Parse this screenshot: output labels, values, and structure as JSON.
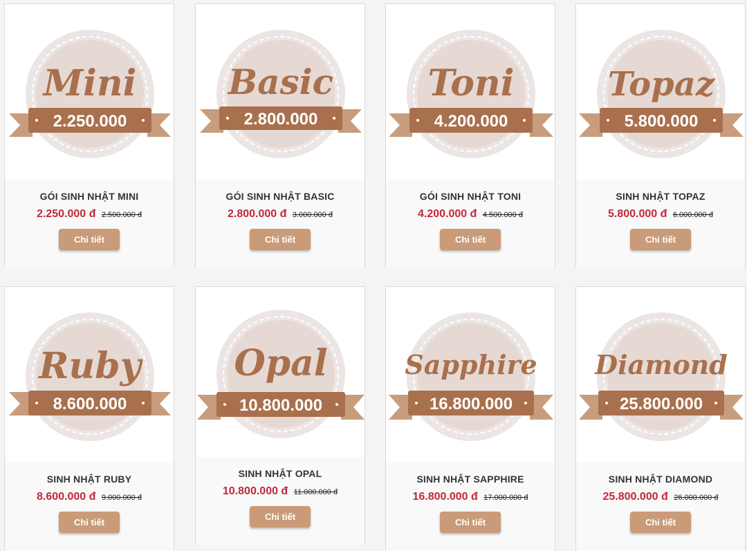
{
  "colors": {
    "price": "#c0283c",
    "button": "#c99b78",
    "ribbon": "#a9704d",
    "ribbon_light": "#c89d7d",
    "badge_ring": "#ebe5e3",
    "script_text": "#a9704d"
  },
  "packages": [
    {
      "badge_name": "Mini",
      "badge_price": "2.250.000",
      "title": "GÓI SINH NHẬT MINI",
      "price": "2.250.000 đ",
      "old_price": "2.500.000 đ",
      "button": "Chi tiết"
    },
    {
      "badge_name": "Basic",
      "badge_price": "2.800.000",
      "title": "GÓI SINH NHẬT BASIC",
      "price": "2.800.000 đ",
      "old_price": "3.000.000 đ",
      "button": "Chi tiết"
    },
    {
      "badge_name": "Toni",
      "badge_price": "4.200.000",
      "title": "GÓI SINH NHẬT TONI",
      "price": "4.200.000 đ",
      "old_price": "4.500.000 đ",
      "button": "Chi tiết"
    },
    {
      "badge_name": "Topaz",
      "badge_price": "5.800.000",
      "title": "SINH NHẬT TOPAZ",
      "price": "5.800.000 đ",
      "old_price": "6.000.000 đ",
      "button": "Chi tiết"
    },
    {
      "badge_name": "Ruby",
      "badge_price": "8.600.000",
      "title": "SINH NHẬT RUBY",
      "price": "8.600.000 đ",
      "old_price": "9.000.000 đ",
      "button": "Chi tiết"
    },
    {
      "badge_name": "Opal",
      "badge_price": "10.800.000",
      "title": "SINH NHẬT OPAL",
      "price": "10.800.000 đ",
      "old_price": "11.000.000 đ",
      "button": "Chi tiết"
    },
    {
      "badge_name": "Sapphire",
      "badge_price": "16.800.000",
      "title": "SINH NHẬT SAPPHIRE",
      "price": "16.800.000 đ",
      "old_price": "17.000.000 đ",
      "button": "Chi tiết"
    },
    {
      "badge_name": "Diamond",
      "badge_price": "25.800.000",
      "title": "SINH NHẬT DIAMOND",
      "price": "25.800.000 đ",
      "old_price": "26.000.000 đ",
      "button": "Chi tiết"
    }
  ]
}
